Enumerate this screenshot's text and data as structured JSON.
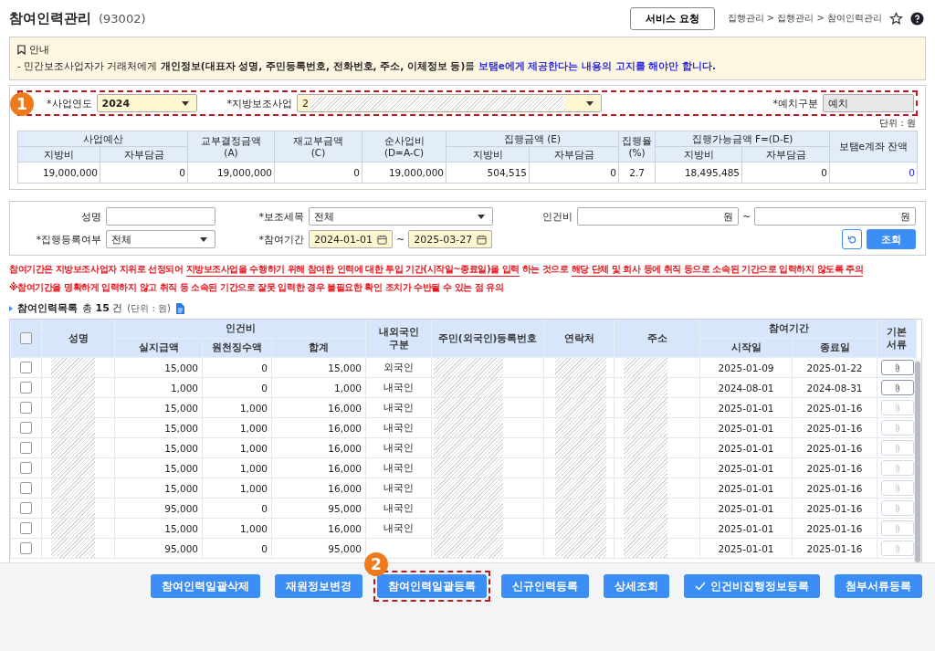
{
  "header": {
    "title": "참여인력관리",
    "code": "(93002)",
    "service_button": "서비스 요청",
    "breadcrumb": "집행관리 > 집행관리 > 참여인력관리"
  },
  "notice": {
    "title": "안내",
    "parts": [
      {
        "kind": "plain",
        "text": "- 민간보조사업자가 거래처에게 "
      },
      {
        "kind": "bold",
        "text": "개인정보(대표자 성명, 주민등록번호, 전화번호, 주소, 이체정보 등)"
      },
      {
        "kind": "plain",
        "text": "를 "
      },
      {
        "kind": "highlight",
        "text": "보탬e에게 제공한다는 내용의 고지를 해야만 합니다."
      }
    ]
  },
  "filter": {
    "badge": "1",
    "year_label": "*사업연도",
    "year": "2024",
    "project_label": "*지방보조사업",
    "project": "2",
    "deposit_label": "*예치구분",
    "deposit": "예치",
    "unit": "단위 : 원"
  },
  "summary": {
    "sub_headers": [
      "지방비",
      "자부담금",
      "지방비",
      "자부담금",
      "지방비",
      "자부담금"
    ],
    "headers": {
      "budget": "사업예산",
      "grant": "교부결정금액\n(A)",
      "regrant": "재교부금액\n(C)",
      "net": "순사업비\n(D=A-C)",
      "exec": "집행금액 (E)",
      "rate": "집행율\n(%)",
      "avail": "집행가능금액 F=(D-E)",
      "balance": "보탬e계좌 잔액"
    },
    "values": [
      "19,000,000",
      "0",
      "19,000,000",
      "0",
      "19,000,000",
      "504,515",
      "0",
      "2.7",
      "18,495,485",
      "0",
      "0"
    ]
  },
  "search": {
    "name_label": "성명",
    "item_label": "*보조세목",
    "item": "전체",
    "cost_label": "인건비",
    "won_from": "원",
    "won_to": "원",
    "tilde": "~",
    "status_label": "*집행등록여부",
    "status": "전체",
    "period_label": "*참여기간",
    "date_from": "2024-01-01",
    "date_to": "2025-03-27",
    "search_button": "조회"
  },
  "warnings": {
    "line1": [
      {
        "kind": "plain",
        "text": "참여기간은 지방보조사업자 지위로 선정되어 "
      },
      {
        "kind": "underline",
        "text": "지방보조사업을 수행하기 위해 참여한 인력에 대한 투입 기간(시작일~종료일)을 입력"
      },
      {
        "kind": "plain",
        "text": " 하는 것으로 "
      },
      {
        "kind": "underline",
        "text": "해당 단체 및 회사 등에 취직 등으로 소속된 기간으로 입력하지 않도록 주의"
      }
    ],
    "line2": "※참여기간을 명확하게 입력하지 않고 취직 등 소속된 기간으로 잘못 입력한 경우 불필요한 확인 조치가 수반될 수 있는 점 유의"
  },
  "list": {
    "title": "참여인력목록",
    "total": "총",
    "count": "15",
    "unit_word": "건",
    "unit": "(단위 : 원)"
  },
  "table": {
    "select_all_checked": false,
    "columns": {
      "name": "성명",
      "cost": "인건비",
      "paid": "실지급액",
      "withheld": "원천징수액",
      "sum": "합계",
      "nation": "내외국인\n구분",
      "id": "주민(외국인)등록번호",
      "phone": "연락처",
      "address": "주소",
      "period": "참여기간",
      "start": "시작일",
      "end": "종료일",
      "docs": "기본\n서류"
    },
    "rows": [
      {
        "checked": false,
        "paid": "15,000",
        "withheld": "0",
        "sum": "15,000",
        "nation": "외국인",
        "start": "2025-01-09",
        "end": "2025-01-22",
        "attach_enabled": true
      },
      {
        "checked": false,
        "paid": "1,000",
        "withheld": "0",
        "sum": "1,000",
        "nation": "내국인",
        "start": "2024-08-01",
        "end": "2024-08-31",
        "attach_enabled": true
      },
      {
        "checked": false,
        "paid": "15,000",
        "withheld": "1,000",
        "sum": "16,000",
        "nation": "내국인",
        "start": "2025-01-01",
        "end": "2025-01-16",
        "attach_enabled": false
      },
      {
        "checked": false,
        "paid": "15,000",
        "withheld": "1,000",
        "sum": "16,000",
        "nation": "내국인",
        "start": "2025-01-01",
        "end": "2025-01-16",
        "attach_enabled": false
      },
      {
        "checked": false,
        "paid": "15,000",
        "withheld": "1,000",
        "sum": "16,000",
        "nation": "내국인",
        "start": "2025-01-01",
        "end": "2025-01-16",
        "attach_enabled": false
      },
      {
        "checked": false,
        "paid": "15,000",
        "withheld": "1,000",
        "sum": "16,000",
        "nation": "내국인",
        "start": "2025-01-01",
        "end": "2025-01-16",
        "attach_enabled": false
      },
      {
        "checked": false,
        "paid": "15,000",
        "withheld": "1,000",
        "sum": "16,000",
        "nation": "내국인",
        "start": "2025-01-01",
        "end": "2025-01-16",
        "attach_enabled": false
      },
      {
        "checked": false,
        "paid": "95,000",
        "withheld": "0",
        "sum": "95,000",
        "nation": "내국인",
        "start": "2025-01-01",
        "end": "2025-01-16",
        "attach_enabled": false
      },
      {
        "checked": false,
        "paid": "15,000",
        "withheld": "1,000",
        "sum": "16,000",
        "nation": "내국인",
        "start": "2025-01-01",
        "end": "2025-01-16",
        "attach_enabled": false
      },
      {
        "checked": false,
        "paid": "95,000",
        "withheld": "0",
        "sum": "95,000",
        "nation": "",
        "start": "2025-01-01",
        "end": "2025-01-16",
        "attach_enabled": false
      }
    ]
  },
  "buttons": [
    {
      "label": "참여인력일괄삭제",
      "highlighted": false,
      "check_icon": false
    },
    {
      "label": "재원정보변경",
      "highlighted": false,
      "check_icon": false
    },
    {
      "label": "참여인력일괄등록",
      "highlighted": true,
      "check_icon": false,
      "badge": "2"
    },
    {
      "label": "신규인력등록",
      "highlighted": false,
      "check_icon": false
    },
    {
      "label": "상세조회",
      "highlighted": false,
      "check_icon": false
    },
    {
      "label": "인건비집행정보등록",
      "highlighted": false,
      "check_icon": true
    },
    {
      "label": "첨부서류등록",
      "highlighted": false,
      "check_icon": false
    }
  ]
}
